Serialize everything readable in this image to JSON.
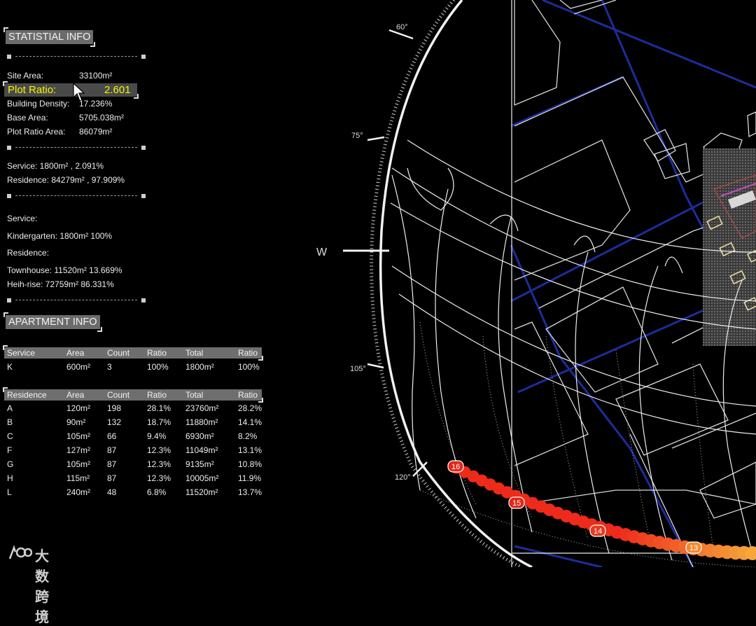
{
  "statistical": {
    "title": "STATISTIAL INFO",
    "site_area_label": "Site Area:",
    "site_area": "33100m²",
    "plot_ratio_label": "Plot Ratio:",
    "plot_ratio": "2.601",
    "building_density_label": "Building Density:",
    "building_density": "17.236%",
    "base_area_label": "Base Area:",
    "base_area": "5705.038m²",
    "plot_ratio_area_label": "Plot Ratio Area:",
    "plot_ratio_area": "86079m²",
    "service_summary": "Service:   1800m² , 2.091%",
    "residence_summary": "Residence:   84279m² , 97.909%",
    "service_heading": "Service:",
    "kindergarten": "Kindergarten:   1800m²  100%",
    "residence_heading": "Residence:",
    "townhouse": "Townhouse:   11520m²  13.669%",
    "high_rise": "Heih-rise:   72759m²  86.331%"
  },
  "apartment": {
    "title": "APARTMENT INFO",
    "service_headers": [
      "Service",
      "Area",
      "Count",
      "Ratio",
      "Total",
      "Ratio"
    ],
    "service_rows": [
      [
        "K",
        "600m²",
        "3",
        "100%",
        "1800m²",
        "100%"
      ]
    ],
    "residence_headers": [
      "Residence",
      "Area",
      "Count",
      "Ratio",
      "Total",
      "Ratio"
    ],
    "residence_rows": [
      [
        "A",
        "120m²",
        "198",
        "28.1%",
        "23760m²",
        "28.2%"
      ],
      [
        "B",
        "90m²",
        "132",
        "18.7%",
        "11880m²",
        "14.1%"
      ],
      [
        "C",
        "105m²",
        "66",
        "9.4%",
        "6930m²",
        "8.2%"
      ],
      [
        "F",
        "127m²",
        "87",
        "12.3%",
        "11049m²",
        "13.1%"
      ],
      [
        "G",
        "105m²",
        "87",
        "12.3%",
        "9135m²",
        "10.8%"
      ],
      [
        "H",
        "115m²",
        "87",
        "12.3%",
        "10005m²",
        "11.9%"
      ],
      [
        "L",
        "240m²",
        "48",
        "6.8%",
        "11520m²",
        "13.7%"
      ]
    ]
  },
  "compass": {
    "direction": "W",
    "angles": [
      "60°",
      "75°",
      "105°",
      "120°"
    ],
    "sun_hours": [
      "16",
      "15",
      "14",
      "13"
    ]
  },
  "logo": {
    "text": "大数跨境"
  },
  "colors": {
    "highlight_text": "#f5f500",
    "sun_red": "#ee2a1a",
    "sun_orange": "#f6a63a",
    "road_blue": "#1c2d9a"
  }
}
